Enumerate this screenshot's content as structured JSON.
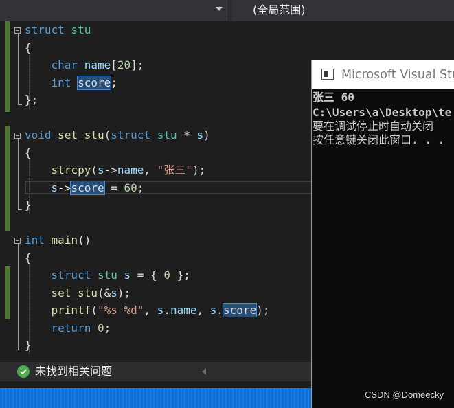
{
  "navbar": {
    "scope_label": "(全局范围)"
  },
  "editor": {
    "lines": [
      {
        "tokens": [
          {
            "c": "kw",
            "t": "struct"
          },
          {
            "c": "pl",
            "t": " "
          },
          {
            "c": "ty",
            "t": "stu"
          }
        ]
      },
      {
        "tokens": [
          {
            "c": "pl",
            "t": "{"
          }
        ]
      },
      {
        "tokens": [
          {
            "c": "pl",
            "t": "    "
          },
          {
            "c": "kw",
            "t": "char"
          },
          {
            "c": "pl",
            "t": " "
          },
          {
            "c": "var",
            "t": "name"
          },
          {
            "c": "pl",
            "t": "["
          },
          {
            "c": "num",
            "t": "20"
          },
          {
            "c": "pl",
            "t": "];"
          }
        ]
      },
      {
        "tokens": [
          {
            "c": "pl",
            "t": "    "
          },
          {
            "c": "kw",
            "t": "int"
          },
          {
            "c": "pl",
            "t": " "
          },
          {
            "c": "hl",
            "t": "score"
          },
          {
            "c": "pl",
            "t": ";"
          }
        ]
      },
      {
        "tokens": [
          {
            "c": "pl",
            "t": "};"
          }
        ]
      },
      {
        "tokens": []
      },
      {
        "tokens": [
          {
            "c": "kw",
            "t": "void"
          },
          {
            "c": "pl",
            "t": " "
          },
          {
            "c": "fn",
            "t": "set_stu"
          },
          {
            "c": "pl",
            "t": "("
          },
          {
            "c": "kw",
            "t": "struct"
          },
          {
            "c": "pl",
            "t": " "
          },
          {
            "c": "ty",
            "t": "stu"
          },
          {
            "c": "pl",
            "t": " * "
          },
          {
            "c": "var",
            "t": "s"
          },
          {
            "c": "pl",
            "t": ")"
          }
        ]
      },
      {
        "tokens": [
          {
            "c": "pl",
            "t": "{"
          }
        ]
      },
      {
        "tokens": [
          {
            "c": "pl",
            "t": "    "
          },
          {
            "c": "fn",
            "t": "strcpy"
          },
          {
            "c": "pl",
            "t": "("
          },
          {
            "c": "var",
            "t": "s"
          },
          {
            "c": "pl",
            "t": "->"
          },
          {
            "c": "var",
            "t": "name"
          },
          {
            "c": "pl",
            "t": ", "
          },
          {
            "c": "str",
            "t": "\"张三\""
          },
          {
            "c": "pl",
            "t": ");"
          }
        ]
      },
      {
        "tokens": [
          {
            "c": "pl",
            "t": "    "
          },
          {
            "c": "var",
            "t": "s"
          },
          {
            "c": "pl",
            "t": "->"
          },
          {
            "c": "hl",
            "t": "score"
          },
          {
            "c": "pl",
            "t": " = "
          },
          {
            "c": "num",
            "t": "60"
          },
          {
            "c": "pl",
            "t": ";"
          }
        ]
      },
      {
        "tokens": [
          {
            "c": "pl",
            "t": "}"
          }
        ]
      },
      {
        "tokens": []
      },
      {
        "tokens": [
          {
            "c": "kw",
            "t": "int"
          },
          {
            "c": "pl",
            "t": " "
          },
          {
            "c": "fn",
            "t": "main"
          },
          {
            "c": "pl",
            "t": "()"
          }
        ]
      },
      {
        "tokens": [
          {
            "c": "pl",
            "t": "{"
          }
        ]
      },
      {
        "tokens": [
          {
            "c": "pl",
            "t": "    "
          },
          {
            "c": "kw",
            "t": "struct"
          },
          {
            "c": "pl",
            "t": " "
          },
          {
            "c": "ty",
            "t": "stu"
          },
          {
            "c": "pl",
            "t": " "
          },
          {
            "c": "var",
            "t": "s"
          },
          {
            "c": "pl",
            "t": " = { "
          },
          {
            "c": "num",
            "t": "0"
          },
          {
            "c": "pl",
            "t": " };"
          }
        ]
      },
      {
        "tokens": [
          {
            "c": "pl",
            "t": "    "
          },
          {
            "c": "fn",
            "t": "set_stu"
          },
          {
            "c": "pl",
            "t": "(&"
          },
          {
            "c": "var",
            "t": "s"
          },
          {
            "c": "pl",
            "t": ");"
          }
        ]
      },
      {
        "tokens": [
          {
            "c": "pl",
            "t": "    "
          },
          {
            "c": "fn",
            "t": "printf"
          },
          {
            "c": "pl",
            "t": "("
          },
          {
            "c": "str",
            "t": "\"%s %d\""
          },
          {
            "c": "pl",
            "t": ", "
          },
          {
            "c": "var",
            "t": "s"
          },
          {
            "c": "pl",
            "t": "."
          },
          {
            "c": "var",
            "t": "name"
          },
          {
            "c": "pl",
            "t": ", "
          },
          {
            "c": "var",
            "t": "s"
          },
          {
            "c": "pl",
            "t": "."
          },
          {
            "c": "hl",
            "t": "score"
          },
          {
            "c": "pl",
            "t": ");"
          }
        ]
      },
      {
        "tokens": [
          {
            "c": "pl",
            "t": "    "
          },
          {
            "c": "kw",
            "t": "return"
          },
          {
            "c": "pl",
            "t": " "
          },
          {
            "c": "num",
            "t": "0"
          },
          {
            "c": "pl",
            "t": ";"
          }
        ]
      },
      {
        "tokens": [
          {
            "c": "pl",
            "t": "}"
          }
        ]
      }
    ]
  },
  "status": {
    "issues_text": "未找到相关问题"
  },
  "console": {
    "title": "Microsoft Visual Stu",
    "lines": [
      "张三 60",
      "C:\\Users\\a\\Desktop\\te",
      "要在调试停止时自动关闭",
      "按任意键关闭此窗口. . ."
    ]
  },
  "watermark": "CSDN @Domeecky",
  "colors": {
    "keyword": "#569cd6",
    "type": "#4ec9b0",
    "function": "#dcdcaa",
    "string": "#d69d85",
    "number": "#b5cea8",
    "variable": "#9cdcfe",
    "highlight": "#264f78",
    "change_bar": "#4d7a2e",
    "status_ok": "#4faa4f",
    "bottom_bar": "#0e6fd4"
  }
}
